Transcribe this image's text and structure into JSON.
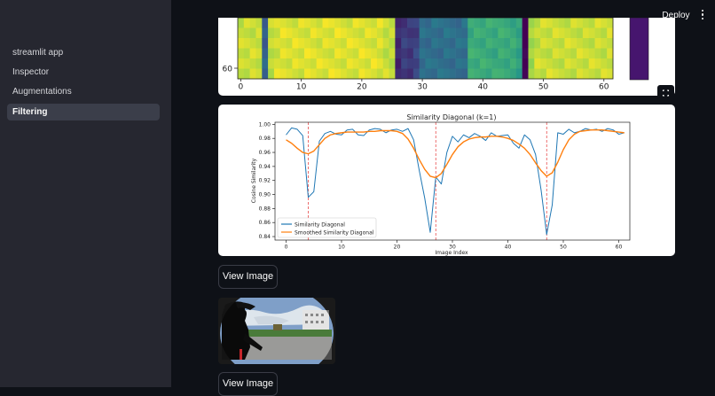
{
  "app": {
    "deploy_label": "Deploy",
    "menu_icon": "kebab-menu-icon"
  },
  "sidebar": {
    "items": [
      {
        "label": "streamlit app",
        "active": false
      },
      {
        "label": "Inspector",
        "active": false
      },
      {
        "label": "Augmentations",
        "active": false
      },
      {
        "label": "Filtering",
        "active": true
      }
    ]
  },
  "heatmap": {
    "y_tick_labels": [
      "60"
    ],
    "x_tick_labels": [
      "0",
      "10",
      "20",
      "30",
      "40",
      "50",
      "60"
    ],
    "expand_icon": "fullscreen-icon"
  },
  "chart_data": {
    "type": "line",
    "title": "Similarity Diagonal (k=1)",
    "xlabel": "Image Index",
    "ylabel": "Cosine Similarity",
    "xlim": [
      -2,
      62
    ],
    "ylim": [
      0.835,
      1.003
    ],
    "x_ticks": [
      0,
      10,
      20,
      30,
      40,
      50,
      60
    ],
    "y_ticks": [
      0.84,
      0.86,
      0.88,
      0.9,
      0.92,
      0.94,
      0.96,
      0.98,
      1.0
    ],
    "legend_position": "lower-left",
    "grid": false,
    "series": [
      {
        "name": "Similarity Diagonal",
        "color": "#1f77b4",
        "values": [
          0.985,
          0.995,
          0.993,
          0.984,
          0.896,
          0.904,
          0.976,
          0.987,
          0.99,
          0.986,
          0.985,
          0.992,
          0.993,
          0.985,
          0.984,
          0.992,
          0.994,
          0.993,
          0.988,
          0.992,
          0.993,
          0.99,
          0.994,
          0.978,
          0.935,
          0.895,
          0.846,
          0.925,
          0.915,
          0.96,
          0.983,
          0.975,
          0.985,
          0.981,
          0.987,
          0.983,
          0.977,
          0.988,
          0.983,
          0.984,
          0.985,
          0.973,
          0.966,
          0.985,
          0.978,
          0.957,
          0.906,
          0.843,
          0.885,
          0.988,
          0.986,
          0.993,
          0.988,
          0.99,
          0.994,
          0.992,
          0.993,
          0.99,
          0.994,
          0.992,
          0.986,
          0.988
        ]
      },
      {
        "name": "Smoothed Similarity Diagonal",
        "color": "#ff7f0e",
        "values": [
          0.978,
          0.973,
          0.966,
          0.96,
          0.958,
          0.962,
          0.971,
          0.98,
          0.985,
          0.987,
          0.988,
          0.989,
          0.989,
          0.989,
          0.989,
          0.99,
          0.99,
          0.991,
          0.991,
          0.991,
          0.99,
          0.987,
          0.979,
          0.966,
          0.95,
          0.936,
          0.926,
          0.924,
          0.93,
          0.943,
          0.957,
          0.968,
          0.975,
          0.979,
          0.981,
          0.982,
          0.982,
          0.983,
          0.983,
          0.982,
          0.98,
          0.977,
          0.972,
          0.966,
          0.957,
          0.945,
          0.934,
          0.926,
          0.931,
          0.946,
          0.964,
          0.978,
          0.986,
          0.99,
          0.991,
          0.992,
          0.992,
          0.992,
          0.991,
          0.99,
          0.989,
          0.988
        ]
      }
    ],
    "change_points": [
      4,
      27,
      47
    ],
    "change_point_color": "#e84a4a"
  },
  "actions": {
    "view_image_label": "View Image"
  }
}
